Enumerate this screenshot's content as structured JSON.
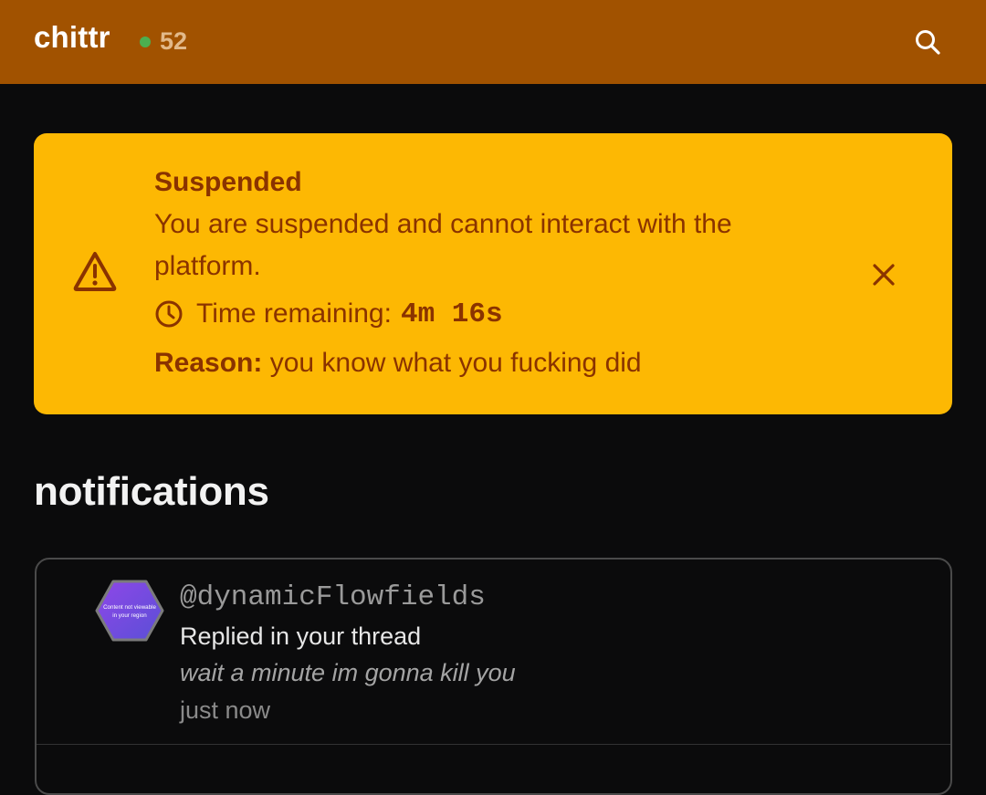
{
  "header": {
    "brand": "chittr",
    "online_count": "52",
    "online_color": "#4caf50",
    "bar_color": "#a15200",
    "search_icon": "search-icon"
  },
  "suspension_alert": {
    "title": "Suspended",
    "message": "You are suspended and cannot interact with the platform.",
    "timer_label": "Time remaining:",
    "timer_value": "4m 16s",
    "reason_label": "Reason:",
    "reason_text": "you know what you fucking did",
    "background_color": "#fdb803",
    "text_color": "#8a3300",
    "icons": [
      "warning-icon",
      "clock-icon",
      "close-icon"
    ]
  },
  "notifications": {
    "title": "notifications",
    "items": [
      {
        "username": "@dynamicFlowfields",
        "action": "Replied in your thread",
        "snippet": "wait a minute im gonna kill you",
        "time": "just now",
        "avatar_text": "Content not viewable in your region"
      }
    ]
  }
}
